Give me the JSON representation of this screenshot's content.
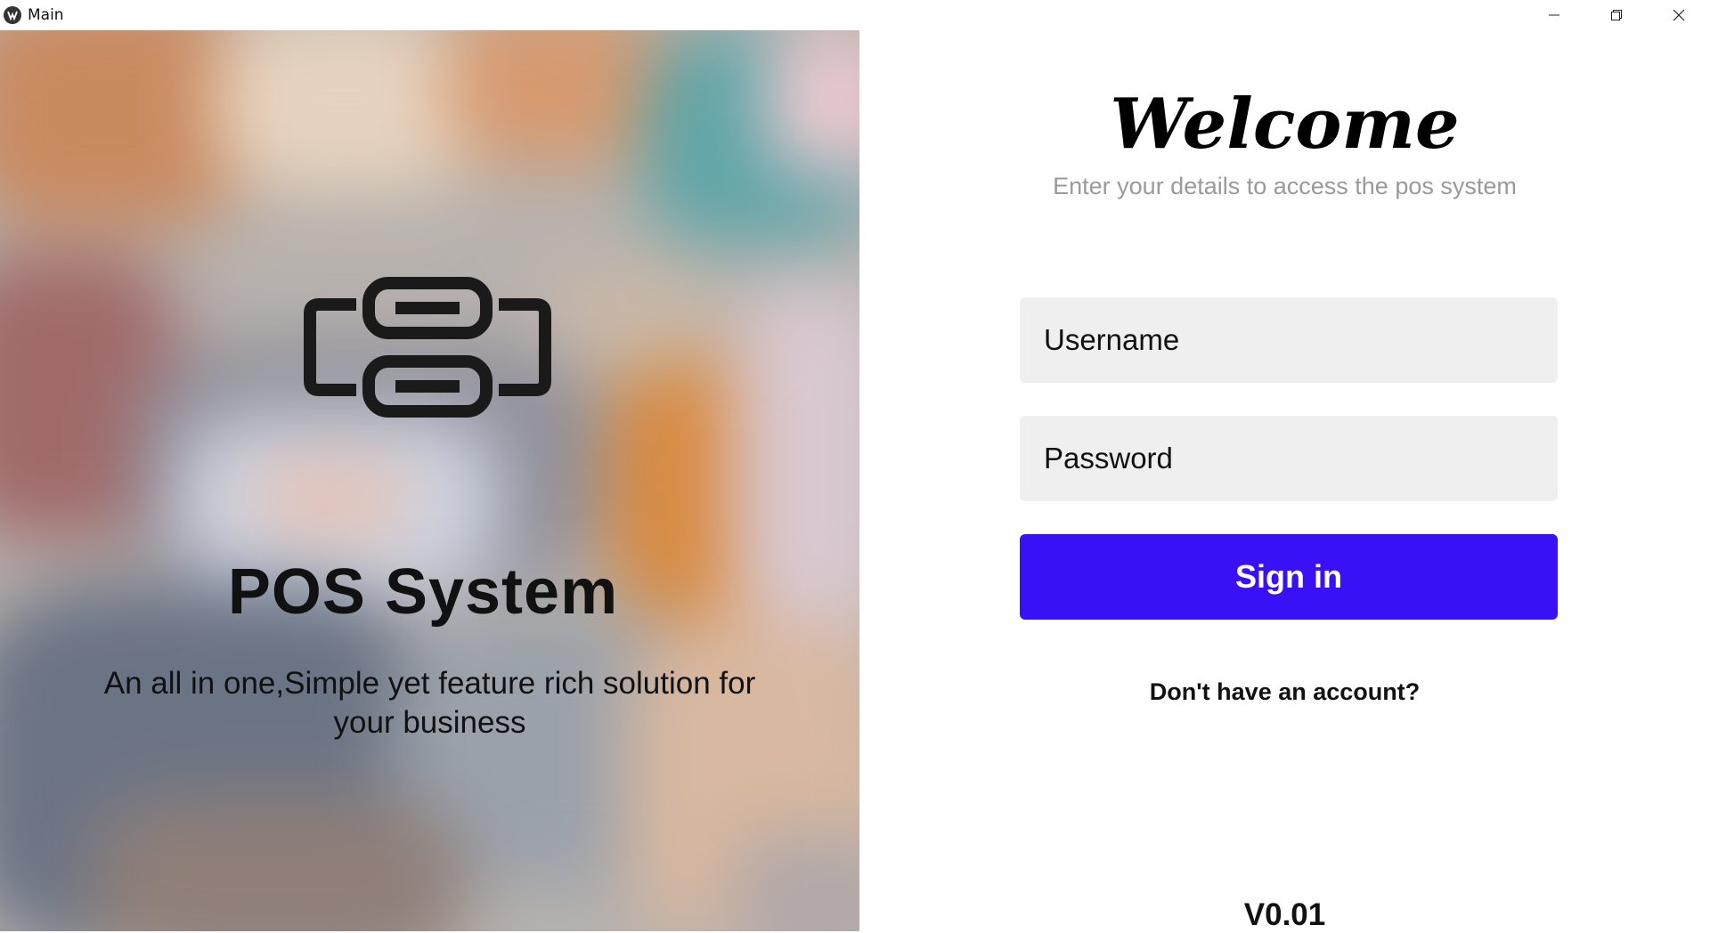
{
  "window": {
    "title": "Main",
    "app_icon": "app-logo-icon",
    "controls": [
      "minimize-icon",
      "restore-icon",
      "close-icon"
    ]
  },
  "left": {
    "logo_icon": "pos-system-logo-icon",
    "heading": "POS System",
    "tagline": "An all in one,Simple yet feature rich solution for your business"
  },
  "right": {
    "welcome": "Welcome",
    "subtitle": "Enter your details to access the pos system",
    "username_placeholder": "Username",
    "password_placeholder": "Password",
    "signin_label": "Sign in",
    "no_account_label": "Don't have an account?",
    "version": "V0.01"
  },
  "colors": {
    "accent": "#3a10f7",
    "field_bg": "#efefef",
    "subtitle": "#9a9a9a"
  }
}
